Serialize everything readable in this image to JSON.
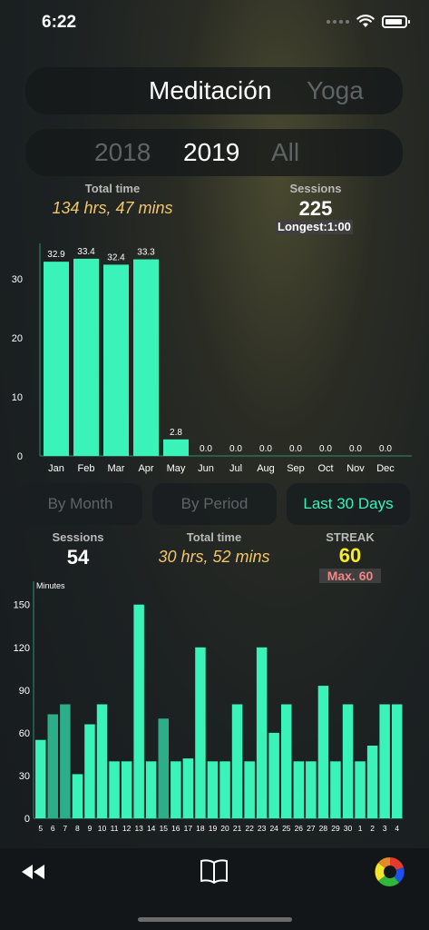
{
  "status": {
    "time": "6:22"
  },
  "activity_tabs": [
    "Meditación",
    "Yoga"
  ],
  "activity_selected": 0,
  "year_tabs": [
    "2018",
    "2019",
    "All"
  ],
  "year_selected": 1,
  "yearly": {
    "total_time_label": "Total time",
    "total_time_value": "134 hrs, 47 mins",
    "sessions_label": "Sessions",
    "sessions_value": "225",
    "longest": "Longest:1:00"
  },
  "filters": [
    "By Month",
    "By Period",
    "Last 30 Days"
  ],
  "filter_selected": 2,
  "recent": {
    "sessions_label": "Sessions",
    "sessions_value": "54",
    "total_time_label": "Total time",
    "total_time_value": "30 hrs, 52 mins",
    "streak_label": "STREAK",
    "streak_value": "60",
    "streak_max": "Max. 60"
  },
  "colors": {
    "accent": "#3af3b8",
    "bar_dim": "#2bae89",
    "yellow": "#f2c66b",
    "streak": "#f7ea2a",
    "max": "#f28585"
  },
  "tabbar": [
    "rewind-icon",
    "book-icon",
    "color-wheel-icon"
  ],
  "chart_data": [
    {
      "type": "bar",
      "categories": [
        "Jan",
        "Feb",
        "Mar",
        "Apr",
        "May",
        "Jun",
        "Jul",
        "Aug",
        "Sep",
        "Oct",
        "Nov",
        "Dec"
      ],
      "values": [
        32.9,
        33.4,
        32.4,
        33.3,
        2.8,
        0.0,
        0.0,
        0.0,
        0.0,
        0.0,
        0.0,
        0.0
      ],
      "data_labels": [
        "32.9",
        "33.4",
        "32.4",
        "33.3",
        "2.8",
        "0.0",
        "0.0",
        "0.0",
        "0.0",
        "0.0",
        "0.0",
        "0.0"
      ],
      "yticks": [
        0,
        10,
        20,
        30
      ],
      "ylim": [
        0,
        36
      ],
      "grid": false
    },
    {
      "type": "bar",
      "ylabel": "Minutes",
      "categories": [
        "5",
        "6",
        "7",
        "8",
        "9",
        "10",
        "11",
        "12",
        "13",
        "14",
        "15",
        "16",
        "17",
        "18",
        "19",
        "20",
        "21",
        "22",
        "23",
        "24",
        "25",
        "26",
        "27",
        "28",
        "29",
        "30",
        "1",
        "2",
        "3",
        "4"
      ],
      "values": [
        55,
        73,
        80,
        31,
        66,
        80,
        40,
        40,
        150,
        40,
        70,
        40,
        42,
        120,
        40,
        40,
        80,
        40,
        120,
        60,
        80,
        40,
        40,
        93,
        40,
        80,
        40,
        51,
        80,
        80
      ],
      "highlighted": [
        false,
        true,
        true,
        false,
        false,
        false,
        false,
        false,
        false,
        false,
        true,
        false,
        false,
        false,
        false,
        false,
        false,
        false,
        false,
        false,
        false,
        false,
        false,
        false,
        false,
        false,
        false,
        false,
        false,
        false
      ],
      "yticks": [
        0,
        30,
        60,
        90,
        120,
        150
      ],
      "ylim": [
        0,
        160
      ],
      "grid": false
    }
  ]
}
